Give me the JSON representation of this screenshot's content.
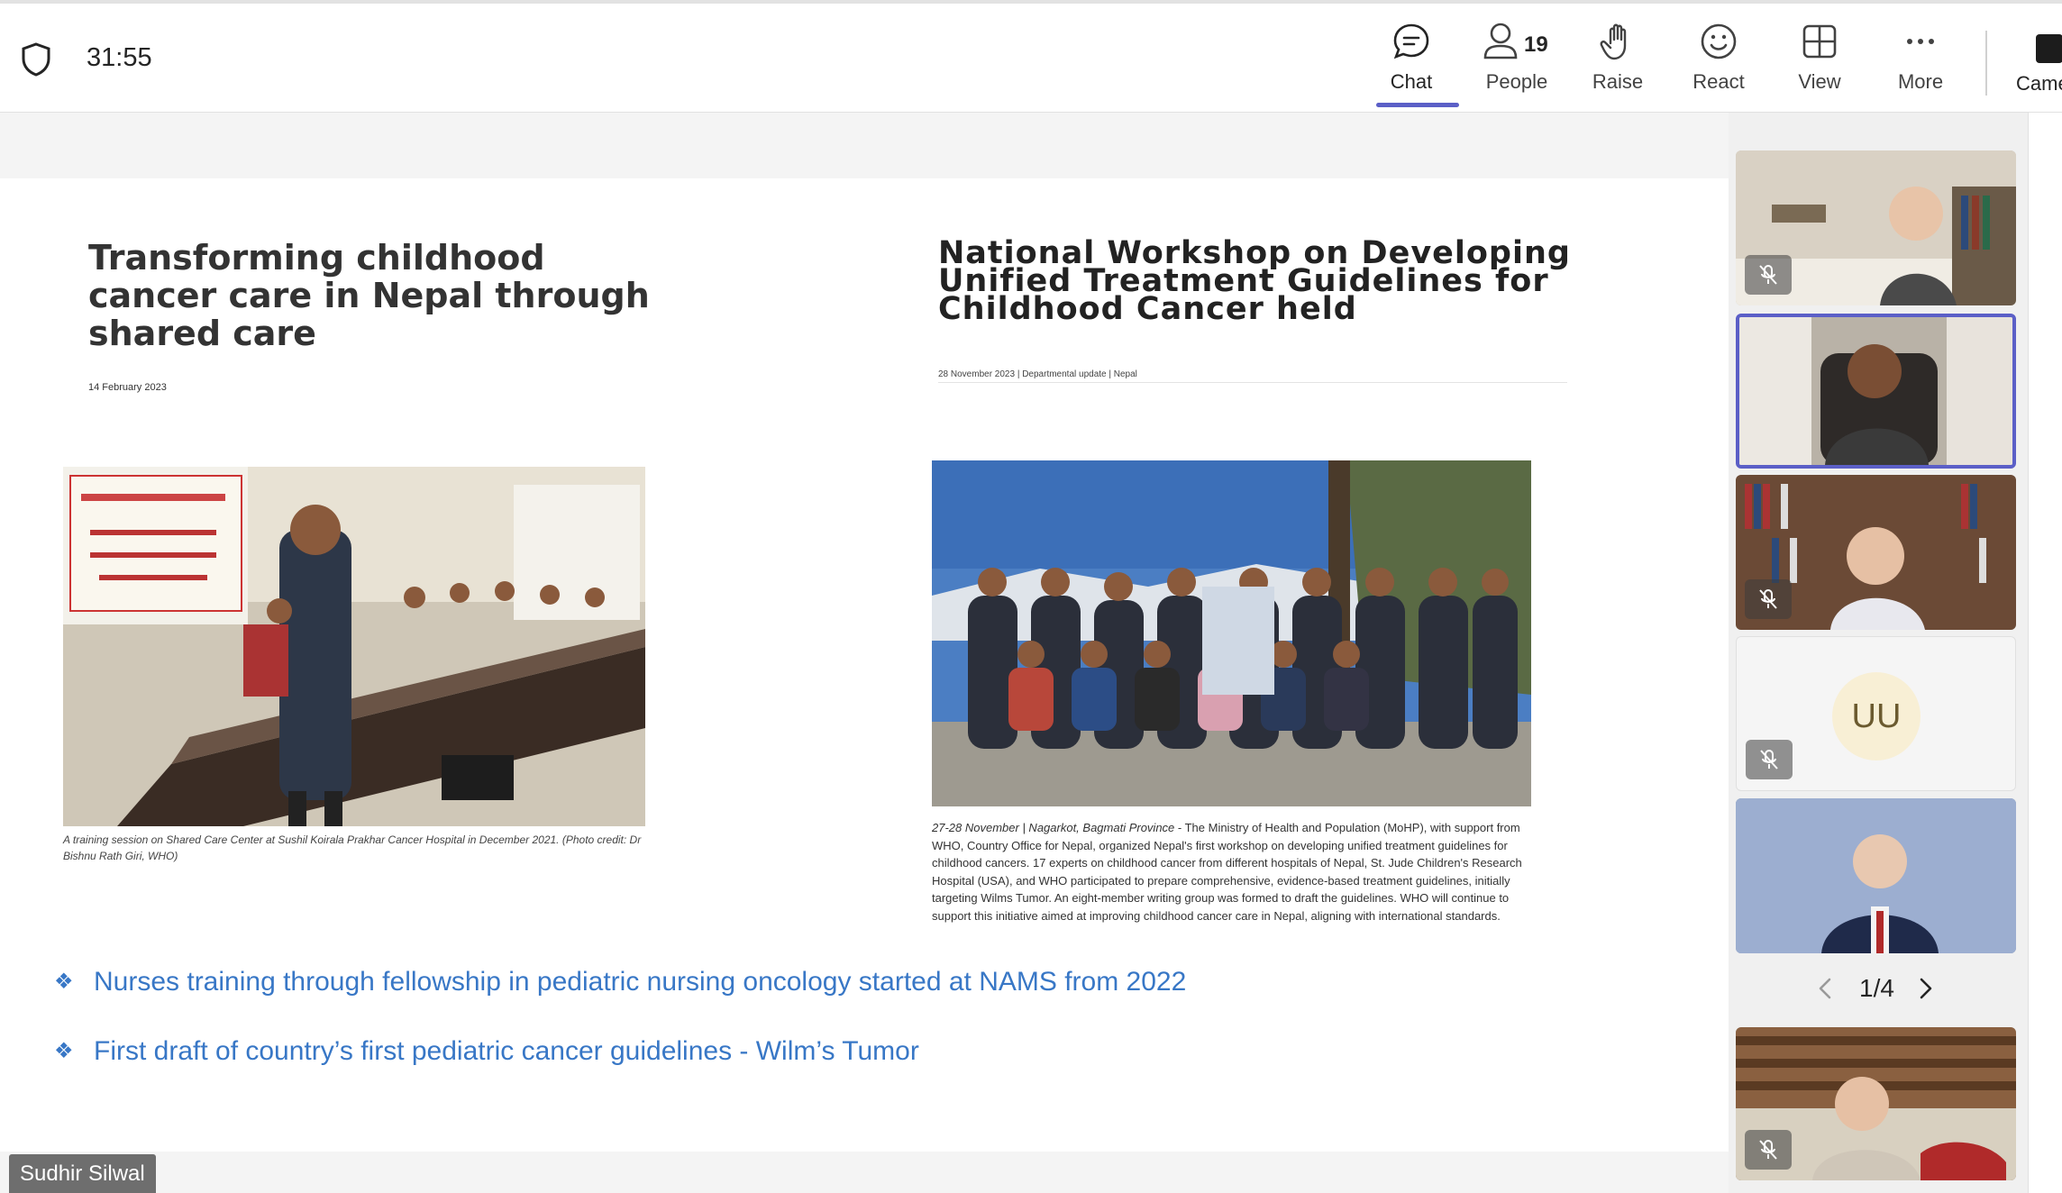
{
  "meeting": {
    "timer": "31:55",
    "toolbar": {
      "chat": "Chat",
      "people": "People",
      "people_count": "19",
      "raise": "Raise",
      "react": "React",
      "view": "View",
      "more": "More",
      "camera": "Came"
    }
  },
  "slide": {
    "left": {
      "title": "Transforming childhood cancer care in Nepal through shared care",
      "date": "14 February 2023",
      "caption": "A training session on Shared Care Center at Sushil Koirala Prakhar Cancer Hospital in December 2021. (Photo credit: Dr Bishnu Rath Giri, WHO)"
    },
    "right": {
      "title": "National Workshop on Developing Unified Treatment Guidelines for Childhood Cancer held",
      "meta": "28 November 2023 | Departmental update | Nepal",
      "body_lead": "27-28 November | Nagarkot, Bagmati Province",
      "body": " - The Ministry of Health and Population (MoHP), with support from WHO, Country Office for Nepal, organized Nepal's first workshop on developing unified treatment guidelines for childhood cancers. 17 experts on childhood cancer from different hospitals of Nepal, St. Jude Children's Research Hospital (USA), and WHO participated to prepare comprehensive, evidence-based treatment guidelines, initially targeting Wilms Tumor. An eight-member writing group was formed to draft the guidelines. WHO will continue to support this initiative aimed at improving childhood cancer care in Nepal, aligning with international standards."
    },
    "bullets": [
      "Nurses training through fellowship in pediatric nursing oncology started at NAMS from 2022",
      "First draft of country’s first pediatric cancer guidelines - Wilm’s Tumor"
    ],
    "bullet_marker": "❖"
  },
  "presenter": "Sudhir Silwal",
  "gallery": {
    "avatar_initials": "UU",
    "pager": "1/4"
  },
  "colors": {
    "accent": "#5b5fc7",
    "bullet_text": "#3877c6"
  }
}
